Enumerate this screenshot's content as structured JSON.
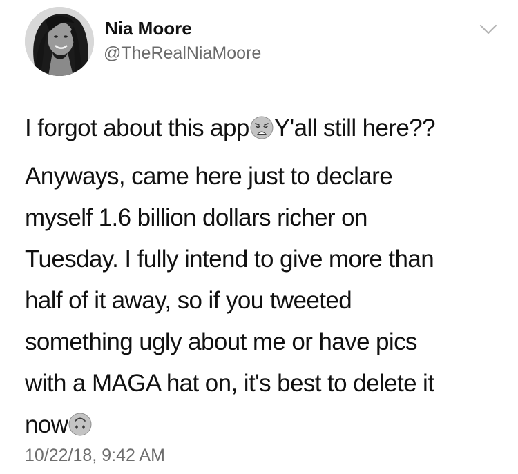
{
  "author": {
    "name": "Nia Moore",
    "handle": "@TheRealNiaMoore",
    "avatar_icon": "profile-photo"
  },
  "menu": {
    "icon": "chevron-down-icon"
  },
  "tweet": {
    "line1_before_emoji": "I forgot about this app",
    "emoji1": "weary-face-emoji",
    "line1_after_emoji": "Y'all still here??",
    "para2_lines": [
      "Anyways, came here just to declare",
      "myself 1.6 billion dollars richer on",
      "Tuesday. I fully intend to give more than",
      "half of it away, so if you tweeted",
      "something ugly about me or have pics",
      "with a MAGA hat on, it's best to delete it"
    ],
    "last_line_text": "now",
    "emoji2": "upside-down-face-emoji",
    "timestamp": "10/22/18, 9:42 AM"
  },
  "colors": {
    "text": "#111111",
    "secondary_text": "#6b6b6b",
    "background": "#ffffff"
  }
}
